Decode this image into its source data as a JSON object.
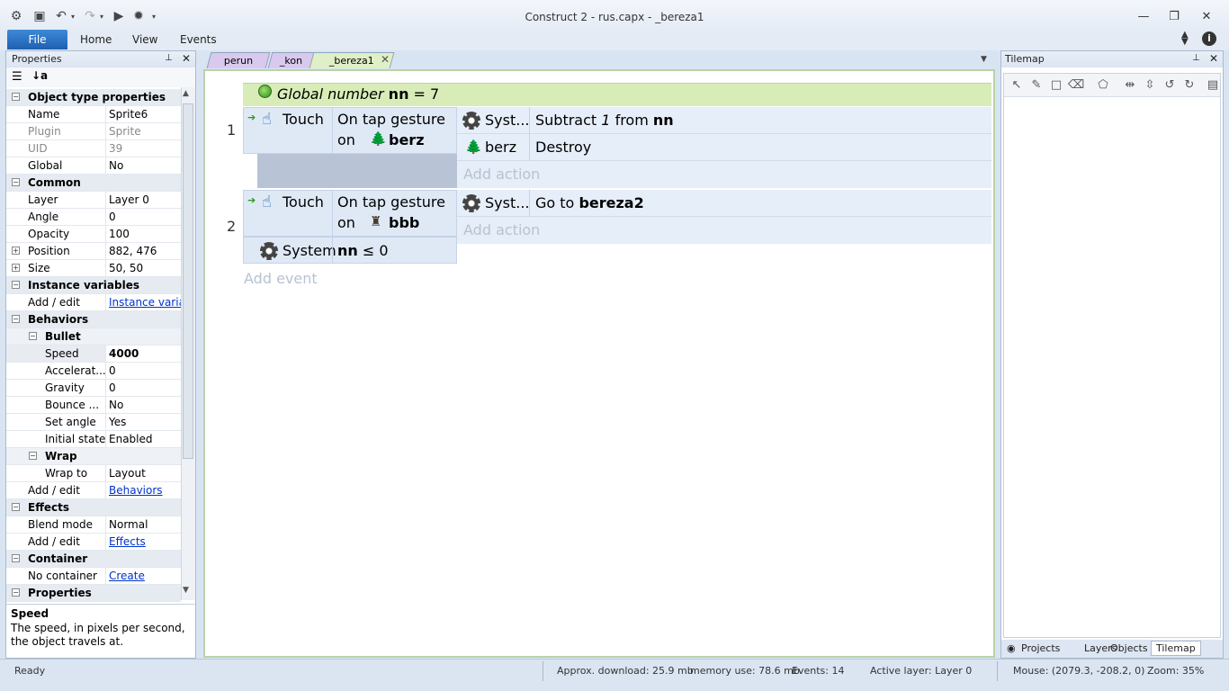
{
  "window": {
    "title": "Construct 2 - rus.capx - _bereza1"
  },
  "ribbon": {
    "file": "File",
    "home": "Home",
    "view": "View",
    "events": "Events"
  },
  "properties": {
    "panel_title": "Properties",
    "rows": {
      "cat_object": "Object type properties",
      "name_k": "Name",
      "name_v": "Sprite6",
      "plugin_k": "Plugin",
      "plugin_v": "Sprite",
      "uid_k": "UID",
      "uid_v": "39",
      "global_k": "Global",
      "global_v": "No",
      "cat_common": "Common",
      "layer_k": "Layer",
      "layer_v": "Layer 0",
      "angle_k": "Angle",
      "angle_v": "0",
      "opacity_k": "Opacity",
      "opacity_v": "100",
      "position_k": "Position",
      "position_v": "882, 476",
      "size_k": "Size",
      "size_v": "50, 50",
      "cat_instvars": "Instance variables",
      "addedit1_k": "Add / edit",
      "addedit1_v": "Instance varia...",
      "cat_behaviors": "Behaviors",
      "bullet": "Bullet",
      "speed_k": "Speed",
      "speed_v": "4000",
      "accel_k": "Accelerat...",
      "accel_v": "0",
      "gravity_k": "Gravity",
      "gravity_v": "0",
      "bounce_k": "Bounce ...",
      "bounce_v": "No",
      "setangle_k": "Set angle",
      "setangle_v": "Yes",
      "initstate_k": "Initial state",
      "initstate_v": "Enabled",
      "wrap": "Wrap",
      "wrapto_k": "Wrap to",
      "wrapto_v": "Layout",
      "addedit2_k": "Add / edit",
      "addedit2_v": "Behaviors",
      "cat_effects": "Effects",
      "blend_k": "Blend mode",
      "blend_v": "Normal",
      "addedit3_k": "Add / edit",
      "addedit3_v": "Effects",
      "cat_container": "Container",
      "nocontainer_k": "No container",
      "nocontainer_v": "Create",
      "cat_properties": "Properties"
    },
    "desc_title": "Speed",
    "desc_text": "The speed, in pixels per second, the object travels at."
  },
  "editor": {
    "tabs": [
      "perun",
      "_kon",
      "_bereza1"
    ],
    "global": {
      "prefix": "Global number",
      "name": "nn",
      "eq": "= 7"
    },
    "event1": {
      "num": "1",
      "cond_obj": "Touch",
      "cond_text1": "On tap gesture",
      "cond_on": "on",
      "cond_target": "berz",
      "act1_obj": "Syst...",
      "act1_pre": "Subtract",
      "act1_num": "1",
      "act1_from": "from",
      "act1_var": "nn",
      "act2_obj": "berz",
      "act2_text": "Destroy",
      "add_action": "Add action"
    },
    "event2": {
      "num": "2",
      "cond_obj": "Touch",
      "cond_text1": "On tap gesture",
      "cond_on": "on",
      "cond_target": "bbb",
      "cond2_obj": "System",
      "cond2_var": "nn",
      "cond2_rest": "≤ 0",
      "act1_obj": "Syst...",
      "act1_pre": "Go to",
      "act1_target": "bereza2",
      "add_action": "Add action"
    },
    "add_event": "Add event"
  },
  "tilemap": {
    "panel_title": "Tilemap",
    "bottom_tabs": [
      "Projects",
      "Layers",
      "Objects",
      "Tilemap"
    ]
  },
  "status": {
    "ready": "Ready",
    "download": "Approx. download: 25.9 mb",
    "memory": "memory use: 78.6 mb",
    "events": "Events: 14",
    "layer": "Active layer: Layer 0",
    "mouse": "Mouse: (2079.3, -208.2, 0)",
    "zoom": "Zoom: 35%"
  },
  "colors": {
    "accent": "#1f5fb3",
    "global_bg": "#d8ecb8",
    "editor_border": "#b9d3a8"
  }
}
